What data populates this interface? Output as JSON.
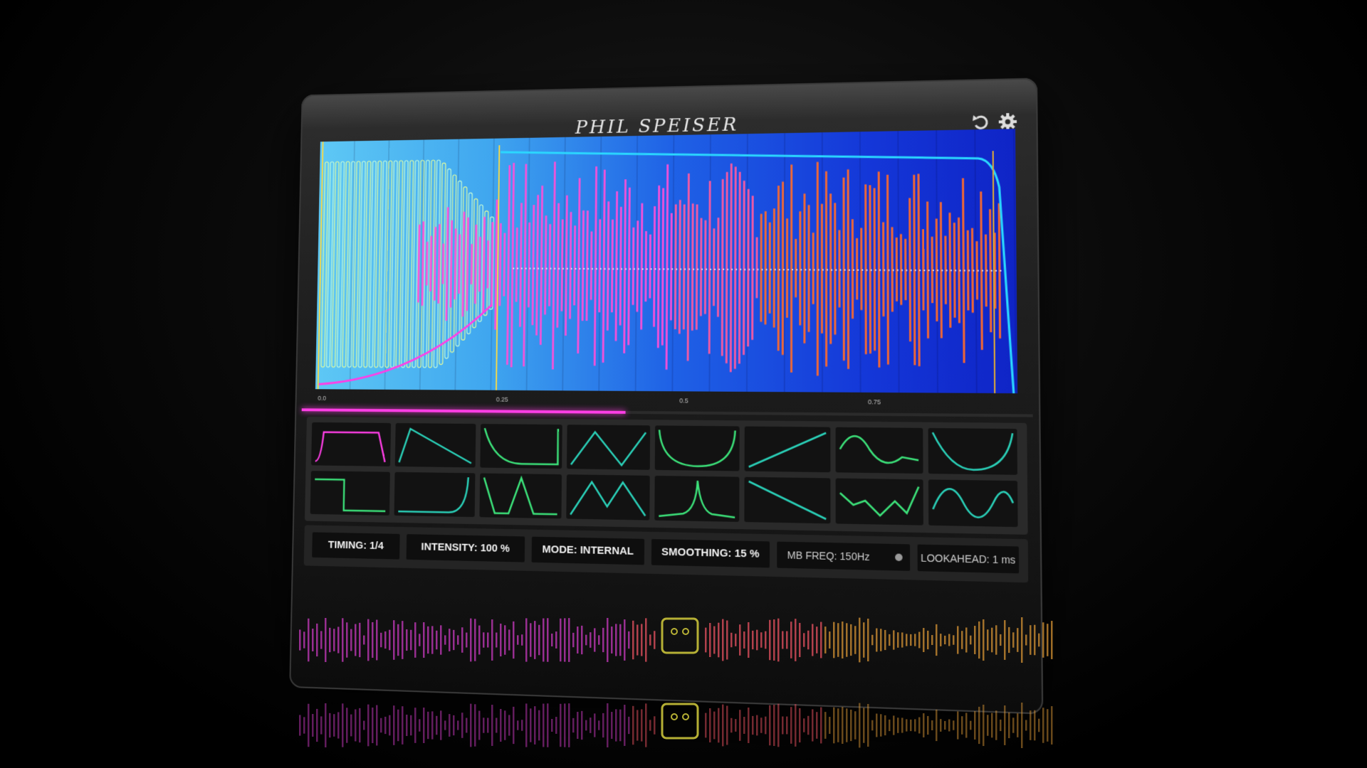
{
  "brand": {
    "title": "PHIL SPEISER"
  },
  "toolbar": {
    "undo_icon": "undo-icon",
    "settings_icon": "gear-icon"
  },
  "colors": {
    "pink": "#ff3ee6",
    "green": "#3ce27a",
    "teal": "#2ad0b8",
    "orange": "#ff6a2a",
    "display_left": "#5ec8f5",
    "display_right": "#0f24c6"
  },
  "timeline": {
    "ticks": [
      "0.0",
      "0.25",
      "0.5",
      "0.75"
    ],
    "progress": 0.46
  },
  "shapes": {
    "selected_index": 0,
    "count": 16
  },
  "params": {
    "timing": "TIMING: 1/4",
    "intensity": "INTENSITY: 100 %",
    "mode": "MODE: INTERNAL",
    "smoothing": "SMOOTHING: 15 %",
    "mb_freq": "MB FREQ: 150Hz",
    "lookahead": "LOOKAHEAD: 1 ms"
  }
}
